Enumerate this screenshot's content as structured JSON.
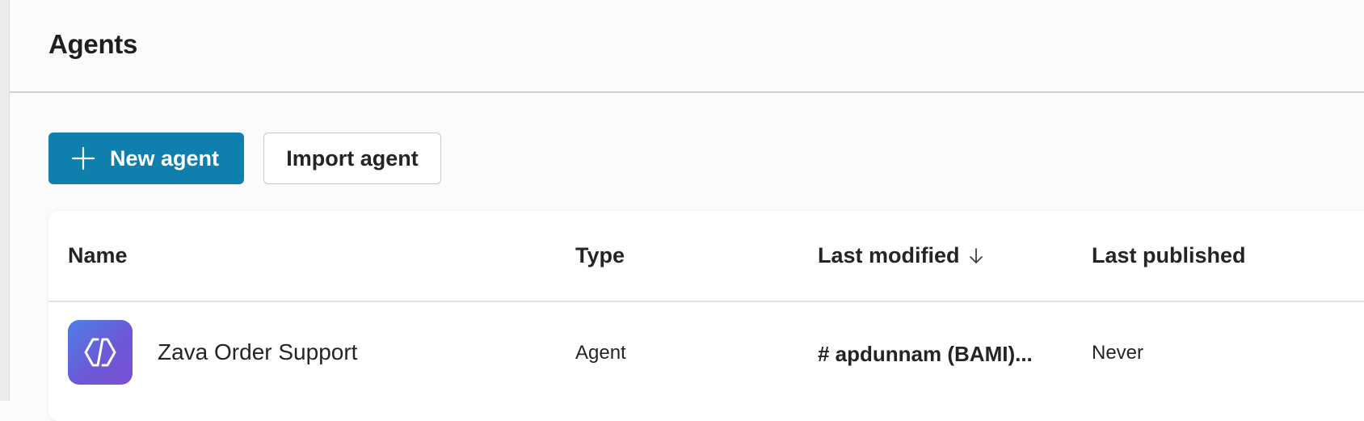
{
  "page": {
    "title": "Agents"
  },
  "toolbar": {
    "new_agent_label": "New agent",
    "import_agent_label": "Import agent",
    "primary_color": "#0f7fae"
  },
  "table": {
    "columns": {
      "name": "Name",
      "type": "Type",
      "last_modified": "Last modified",
      "last_published": "Last published"
    },
    "sort": {
      "column": "last_modified",
      "direction": "descending"
    },
    "rows": [
      {
        "icon": "code-brackets-icon",
        "name": "Zava Order Support",
        "type": "Agent",
        "last_modified": "# apdunnam (BAMI)...",
        "last_published": "Never"
      }
    ]
  }
}
